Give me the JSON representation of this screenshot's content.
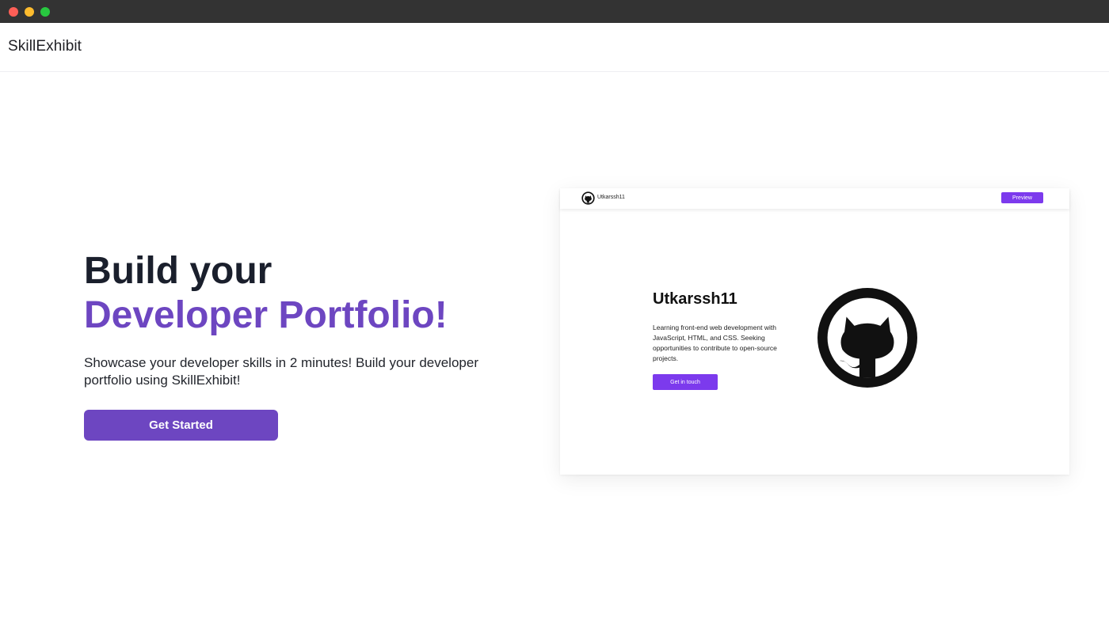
{
  "window": {
    "controls": [
      "close",
      "minimize",
      "maximize"
    ]
  },
  "navbar": {
    "brand": "SkillExhibit"
  },
  "hero": {
    "title_line1": "Build your",
    "title_line2": "Developer Portfolio!",
    "description": "Showcase your developer skills in 2 minutes! Build your developer portfolio using SkillExhibit!",
    "cta_label": "Get Started"
  },
  "preview": {
    "nav_username": "Utkarssh11",
    "nav_button": "Preview",
    "title": "Utkarssh11",
    "bio": "Learning front-end web development with JavaScript, HTML, and CSS. Seeking opportunities to contribute to open-source projects.",
    "contact_button": "Get in touch",
    "logo_icon": "github-icon",
    "avatar_icon": "github-icon"
  },
  "colors": {
    "accent": "#6d46c1",
    "preview_accent": "#7c3aed",
    "titlebar": "#333333",
    "heading": "#1a1f2c"
  }
}
